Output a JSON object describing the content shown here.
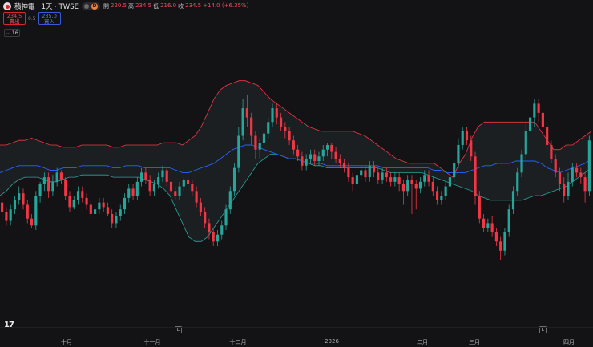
{
  "symbol": {
    "name": "積神電 · 1天 · TWSE",
    "interval_badge": "D",
    "ohlc": {
      "open_label": "開",
      "open": "220.5",
      "high_label": "高",
      "high": "234.5",
      "low_label": "低",
      "low": "216.0",
      "close_label": "收",
      "close": "234.5",
      "change": "+14.0 (+6.35%)"
    }
  },
  "trade": {
    "sell_price": "234.5",
    "sell_label": "賣出",
    "spread": "0.5",
    "buy_price": "235.0",
    "buy_label": "買入"
  },
  "indicators": {
    "count": "16"
  },
  "time_axis": {
    "labels": [
      "十月",
      "十一月",
      "十二月",
      "2026",
      "二月",
      "三月",
      "四月"
    ],
    "earnings_marker": "E"
  },
  "colors": {
    "up": "#26a69a",
    "down": "#f23645",
    "ma": "#2962ff",
    "upper_band": "#f23645",
    "lower_band": "#26a69a",
    "band_fill": "#1b1f22",
    "background": "#131315"
  },
  "chart_data": {
    "type": "candlestick",
    "overlay": "bollinger_bands",
    "note_values": "relative price levels estimated from chart (no price axis visible)",
    "candles": [
      [
        47,
        43,
        52,
        39
      ],
      [
        43,
        39,
        45,
        37
      ],
      [
        39,
        44,
        46,
        37
      ],
      [
        44,
        48,
        50,
        42
      ],
      [
        48,
        51,
        54,
        46
      ],
      [
        51,
        46,
        53,
        44
      ],
      [
        46,
        40,
        48,
        38
      ],
      [
        40,
        37,
        42,
        36
      ],
      [
        37,
        50,
        52,
        35
      ],
      [
        50,
        55,
        56,
        47
      ],
      [
        55,
        58,
        60,
        52
      ],
      [
        58,
        52,
        60,
        49
      ],
      [
        52,
        56,
        59,
        50
      ],
      [
        56,
        60,
        62,
        54
      ],
      [
        60,
        57,
        61,
        55
      ],
      [
        57,
        50,
        58,
        48
      ],
      [
        50,
        45,
        52,
        43
      ],
      [
        45,
        48,
        50,
        44
      ],
      [
        48,
        52,
        54,
        46
      ],
      [
        52,
        49,
        54,
        47
      ],
      [
        49,
        46,
        51,
        44
      ],
      [
        46,
        42,
        48,
        40
      ],
      [
        42,
        44,
        46,
        41
      ],
      [
        44,
        47,
        49,
        42
      ],
      [
        47,
        45,
        49,
        43
      ],
      [
        45,
        42,
        47,
        41
      ],
      [
        42,
        38,
        44,
        36
      ],
      [
        38,
        41,
        43,
        36
      ],
      [
        41,
        44,
        46,
        39
      ],
      [
        44,
        49,
        51,
        42
      ],
      [
        49,
        53,
        55,
        47
      ],
      [
        53,
        50,
        55,
        48
      ],
      [
        50,
        56,
        58,
        48
      ],
      [
        56,
        60,
        62,
        54
      ],
      [
        60,
        57,
        62,
        55
      ],
      [
        57,
        52,
        59,
        50
      ],
      [
        52,
        55,
        57,
        50
      ],
      [
        55,
        58,
        60,
        53
      ],
      [
        58,
        61,
        63,
        56
      ],
      [
        61,
        56,
        62,
        54
      ],
      [
        56,
        52,
        58,
        50
      ],
      [
        52,
        50,
        54,
        48
      ],
      [
        50,
        54,
        56,
        48
      ],
      [
        54,
        57,
        58,
        52
      ],
      [
        57,
        55,
        59,
        53
      ],
      [
        55,
        52,
        57,
        50
      ],
      [
        52,
        47,
        54,
        45
      ],
      [
        47,
        43,
        49,
        41
      ],
      [
        43,
        38,
        45,
        36
      ],
      [
        38,
        34,
        40,
        31
      ],
      [
        34,
        30,
        36,
        28
      ],
      [
        30,
        33,
        35,
        28
      ],
      [
        33,
        37,
        39,
        31
      ],
      [
        37,
        44,
        46,
        35
      ],
      [
        44,
        52,
        54,
        42
      ],
      [
        52,
        62,
        64,
        50
      ],
      [
        62,
        76,
        80,
        60
      ],
      [
        76,
        88,
        92,
        74
      ],
      [
        88,
        84,
        94,
        80
      ],
      [
        84,
        76,
        86,
        72
      ],
      [
        76,
        70,
        78,
        66
      ],
      [
        70,
        73,
        75,
        66
      ],
      [
        73,
        77,
        79,
        71
      ],
      [
        77,
        82,
        84,
        75
      ],
      [
        82,
        88,
        90,
        80
      ],
      [
        88,
        84,
        90,
        81
      ],
      [
        84,
        80,
        86,
        78
      ],
      [
        80,
        78,
        82,
        75
      ],
      [
        78,
        74,
        80,
        72
      ],
      [
        74,
        70,
        76,
        68
      ],
      [
        70,
        67,
        72,
        65
      ],
      [
        67,
        63,
        69,
        61
      ],
      [
        63,
        66,
        68,
        61
      ],
      [
        66,
        68,
        70,
        64
      ],
      [
        68,
        65,
        70,
        63
      ],
      [
        65,
        67,
        69,
        63
      ],
      [
        67,
        70,
        72,
        65
      ],
      [
        70,
        72,
        73,
        67
      ],
      [
        72,
        69,
        73,
        66
      ],
      [
        69,
        66,
        71,
        64
      ],
      [
        66,
        64,
        68,
        62
      ],
      [
        64,
        62,
        66,
        60
      ],
      [
        62,
        58,
        64,
        56
      ],
      [
        58,
        55,
        60,
        52
      ],
      [
        55,
        59,
        61,
        53
      ],
      [
        59,
        61,
        63,
        57
      ],
      [
        61,
        58,
        63,
        56
      ],
      [
        58,
        63,
        65,
        56
      ],
      [
        63,
        60,
        65,
        58
      ],
      [
        60,
        57,
        62,
        55
      ],
      [
        57,
        60,
        62,
        55
      ],
      [
        60,
        58,
        62,
        56
      ],
      [
        58,
        56,
        60,
        54
      ],
      [
        56,
        58,
        60,
        54
      ],
      [
        58,
        55,
        60,
        52
      ],
      [
        55,
        52,
        57,
        46
      ],
      [
        52,
        57,
        59,
        50
      ],
      [
        57,
        55,
        59,
        42
      ],
      [
        55,
        53,
        57,
        44
      ],
      [
        53,
        56,
        58,
        51
      ],
      [
        56,
        59,
        61,
        54
      ],
      [
        59,
        56,
        61,
        54
      ],
      [
        56,
        52,
        58,
        50
      ],
      [
        52,
        48,
        54,
        46
      ],
      [
        48,
        50,
        52,
        46
      ],
      [
        50,
        54,
        56,
        48
      ],
      [
        54,
        58,
        60,
        52
      ],
      [
        58,
        64,
        66,
        56
      ],
      [
        64,
        72,
        75,
        62
      ],
      [
        72,
        78,
        80,
        70
      ],
      [
        78,
        74,
        80,
        72
      ],
      [
        74,
        67,
        76,
        65
      ],
      [
        67,
        50,
        69,
        46
      ],
      [
        50,
        40,
        52,
        38
      ],
      [
        40,
        36,
        42,
        34
      ],
      [
        36,
        38,
        40,
        34
      ],
      [
        38,
        34,
        41,
        32
      ],
      [
        34,
        30,
        36,
        28
      ],
      [
        30,
        26,
        32,
        22
      ],
      [
        26,
        34,
        36,
        24
      ],
      [
        34,
        44,
        46,
        32
      ],
      [
        44,
        52,
        54,
        42
      ],
      [
        52,
        60,
        62,
        50
      ],
      [
        60,
        68,
        70,
        58
      ],
      [
        68,
        78,
        82,
        66
      ],
      [
        78,
        84,
        88,
        76
      ],
      [
        84,
        90,
        92,
        80
      ],
      [
        90,
        86,
        92,
        82
      ],
      [
        86,
        80,
        88,
        78
      ],
      [
        80,
        72,
        82,
        70
      ],
      [
        72,
        66,
        74,
        64
      ],
      [
        66,
        60,
        68,
        58
      ],
      [
        60,
        55,
        62,
        52
      ],
      [
        55,
        50,
        58,
        47
      ],
      [
        50,
        56,
        60,
        48
      ],
      [
        56,
        62,
        64,
        54
      ],
      [
        62,
        60,
        64,
        58
      ],
      [
        60,
        58,
        62,
        55
      ],
      [
        58,
        52,
        60,
        47
      ],
      [
        52,
        74,
        76,
        50
      ]
    ],
    "upper_band": [
      72,
      72,
      73,
      74,
      74,
      75,
      74,
      73,
      72,
      72,
      71,
      71,
      71,
      72,
      72,
      72,
      72,
      72,
      71,
      71,
      72,
      72,
      72,
      72,
      72,
      72,
      73,
      73,
      73,
      72,
      74,
      76,
      80,
      86,
      92,
      96,
      98,
      99,
      100,
      100,
      99,
      98,
      95,
      92,
      90,
      88,
      86,
      84,
      82,
      80,
      79,
      78,
      78,
      78,
      78,
      78,
      78,
      77,
      76,
      74,
      72,
      70,
      68,
      66,
      65,
      64,
      64,
      64,
      64,
      64,
      62,
      60,
      58,
      64,
      68,
      75,
      80,
      82,
      82,
      82,
      82,
      82,
      82,
      82,
      82,
      82,
      78,
      74,
      70,
      70,
      72,
      72,
      74,
      76,
      78
    ],
    "lower_band": [
      50,
      52,
      55,
      57,
      58,
      58,
      58,
      57,
      56,
      56,
      57,
      58,
      58,
      59,
      59,
      59,
      59,
      59,
      58,
      58,
      58,
      58,
      58,
      57,
      56,
      55,
      53,
      50,
      44,
      38,
      32,
      30,
      30,
      32,
      36,
      40,
      44,
      48,
      52,
      56,
      60,
      64,
      66,
      68,
      68,
      67,
      66,
      66,
      65,
      64,
      63,
      63,
      62,
      62,
      62,
      62,
      62,
      62,
      62,
      62,
      62,
      61,
      60,
      60,
      60,
      60,
      60,
      60,
      59,
      58,
      57,
      56,
      55,
      54,
      53,
      52,
      50,
      49,
      48,
      48,
      48,
      48,
      48,
      48,
      49,
      50,
      50,
      51,
      52,
      53,
      54,
      56,
      58,
      60,
      62
    ],
    "middle_band": [
      60,
      61,
      62,
      63,
      63,
      63,
      63,
      62,
      61,
      61,
      62,
      62,
      62,
      63,
      63,
      63,
      63,
      63,
      62,
      62,
      63,
      63,
      63,
      62,
      62,
      62,
      62,
      62,
      61,
      60,
      60,
      61,
      62,
      63,
      64,
      66,
      68,
      70,
      71,
      72,
      72,
      71,
      70,
      69,
      68,
      67,
      66,
      66,
      65,
      64,
      64,
      64,
      63,
      63,
      63,
      63,
      63,
      63,
      63,
      63,
      63,
      62,
      62,
      62,
      62,
      62,
      62,
      62,
      62,
      61,
      61,
      60,
      60,
      60,
      60,
      61,
      62,
      63,
      63,
      64,
      64,
      64,
      65,
      65,
      65,
      65,
      64,
      62,
      61,
      60,
      61,
      62,
      63,
      64,
      66
    ]
  }
}
